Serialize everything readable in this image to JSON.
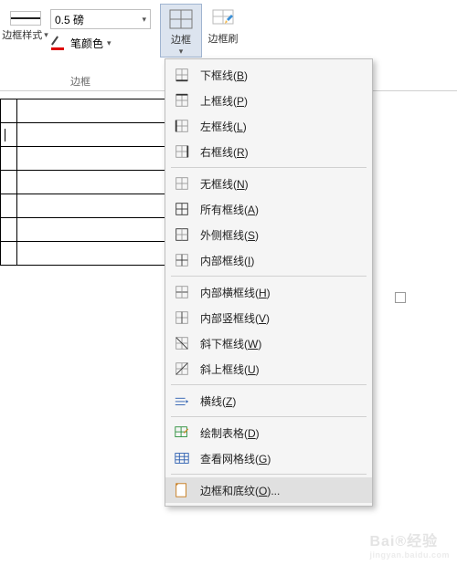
{
  "ribbon": {
    "style_label": "边框样式",
    "weight_value": "0.5 磅",
    "pen_color_label": "笔颜色",
    "border_btn_label": "边框",
    "painter_label": "边框刷",
    "group_label": "边框"
  },
  "table": {
    "rows": 7,
    "cols": 3,
    "cursor_row": 1,
    "cursor_col": 0
  },
  "menu": {
    "items": [
      {
        "label": "下框线(",
        "key": "B",
        "suffix": ")",
        "name": "border-bottom",
        "seg": 0
      },
      {
        "label": "上框线(",
        "key": "P",
        "suffix": ")",
        "name": "border-top",
        "seg": 0
      },
      {
        "label": "左框线(",
        "key": "L",
        "suffix": ")",
        "name": "border-left",
        "seg": 0
      },
      {
        "label": "右框线(",
        "key": "R",
        "suffix": ")",
        "name": "border-right",
        "seg": 0
      },
      {
        "label": "无框线(",
        "key": "N",
        "suffix": ")",
        "name": "border-none",
        "seg": 1
      },
      {
        "label": "所有框线(",
        "key": "A",
        "suffix": ")",
        "name": "border-all",
        "seg": 1
      },
      {
        "label": "外侧框线(",
        "key": "S",
        "suffix": ")",
        "name": "border-outside",
        "seg": 1
      },
      {
        "label": "内部框线(",
        "key": "I",
        "suffix": ")",
        "name": "border-inside",
        "seg": 1
      },
      {
        "label": "内部横框线(",
        "key": "H",
        "suffix": ")",
        "name": "border-inside-h",
        "seg": 2
      },
      {
        "label": "内部竖框线(",
        "key": "V",
        "suffix": ")",
        "name": "border-inside-v",
        "seg": 2
      },
      {
        "label": "斜下框线(",
        "key": "W",
        "suffix": ")",
        "name": "border-diag-down",
        "seg": 2
      },
      {
        "label": "斜上框线(",
        "key": "U",
        "suffix": ")",
        "name": "border-diag-up",
        "seg": 2
      },
      {
        "label": "横线(",
        "key": "Z",
        "suffix": ")",
        "name": "horizontal-line",
        "seg": 3
      },
      {
        "label": "绘制表格(",
        "key": "D",
        "suffix": ")",
        "name": "draw-table",
        "seg": 4
      },
      {
        "label": "查看网格线(",
        "key": "G",
        "suffix": ")",
        "name": "view-gridlines",
        "seg": 4
      },
      {
        "label": "边框和底纹(",
        "key": "O",
        "suffix": ")...",
        "name": "borders-and-shading",
        "seg": 5,
        "hover": true
      }
    ]
  },
  "watermark": {
    "brand": "Bai®经验",
    "sub": "jingyan.baidu.com"
  }
}
